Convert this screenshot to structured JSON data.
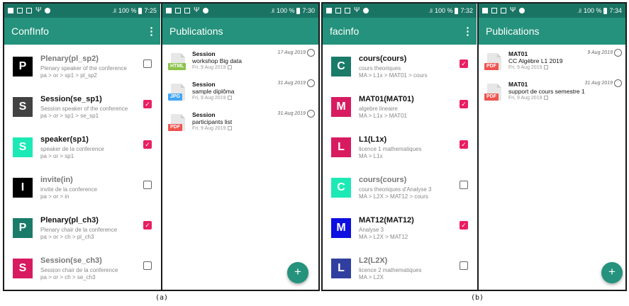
{
  "colors": {
    "statusbar": "#1a7464",
    "appbar": "#24927c",
    "checkbox_checked": "#e91e63",
    "html_tag": "#8bc34a",
    "jpg_tag": "#42a5f5",
    "pdf_tag": "#ef5350"
  },
  "panel_a": {
    "caption": "(a)",
    "screen1": {
      "status": {
        "signal": ".il",
        "battery": "100 %",
        "time": "7:25"
      },
      "title": "ConfInfo",
      "menu_icon": "more-vert-icon",
      "items": [
        {
          "letter": "P",
          "title": "Plenary(pl_sp2)",
          "subtitle": "Plenary speaker of the conference",
          "path": "pa > or > sp1 > pl_sp2",
          "checked": false,
          "color": "#000000"
        },
        {
          "letter": "S",
          "title": "Session(se_sp1)",
          "subtitle": "Session speaker of the conference",
          "path": "pa > or > sp1 > se_sp1",
          "checked": true,
          "color": "#424242"
        },
        {
          "letter": "S",
          "title": "speaker(sp1)",
          "subtitle": "speaker de la conference",
          "path": "pa > or > sp1",
          "checked": true,
          "color": "#1de9b6"
        },
        {
          "letter": "I",
          "title": "invite(in)",
          "subtitle": "invite de la conference",
          "path": "pa > or > in",
          "checked": false,
          "color": "#000000"
        },
        {
          "letter": "P",
          "title": "Plenary(pl_ch3)",
          "subtitle": "Plenary chair de la conference",
          "path": "pa > or > ch > pl_ch3",
          "checked": true,
          "color": "#1a7b69"
        },
        {
          "letter": "S",
          "title": "Session(se_ch3)",
          "subtitle": "Session chair de la conference",
          "path": "pa > or > ch > se_ch3",
          "checked": false,
          "color": "#d81b60"
        }
      ]
    },
    "screen2": {
      "status": {
        "signal": ".il",
        "battery": "100 %",
        "time": "7:30"
      },
      "title": "Publications",
      "publications": [
        {
          "name": "Session",
          "description": "workshop Big data",
          "date": "Fri, 9 Aug 2019",
          "time": "17 Aug 2019",
          "filetype": "HTML"
        },
        {
          "name": "Session",
          "description": "sample diplôma",
          "date": "Fri, 9 Aug 2019",
          "time": "31 Aug 2019",
          "filetype": "JPG"
        },
        {
          "name": "Session",
          "description": "participants list",
          "date": "Fri, 9 Aug 2019",
          "time": "31 Aug 2019",
          "filetype": "PDF"
        }
      ],
      "fab_label": "+"
    }
  },
  "panel_b": {
    "caption": "(b)",
    "screen1": {
      "status": {
        "signal": ".il",
        "battery": "100 %",
        "time": "7:32"
      },
      "title": "facinfo",
      "menu_icon": "more-vert-icon",
      "items": [
        {
          "letter": "C",
          "title": "cours(cours)",
          "subtitle": "cours theoriques",
          "path": "MA > L1x > MAT01 > cours",
          "checked": true,
          "color": "#1a7b69"
        },
        {
          "letter": "M",
          "title": "MAT01(MAT01)",
          "subtitle": "algebre lineaire",
          "path": "MA > L1x > MAT01",
          "checked": true,
          "color": "#d81b60"
        },
        {
          "letter": "L",
          "title": "L1(L1x)",
          "subtitle": "licence 1 mathematiques",
          "path": "MA > L1x",
          "checked": true,
          "color": "#d81b60"
        },
        {
          "letter": "C",
          "title": "cours(cours)",
          "subtitle": "cours theoriques d'Analyse 3",
          "path": "MA > L2X > MAT12 > cours",
          "checked": false,
          "color": "#1de9b6"
        },
        {
          "letter": "M",
          "title": "MAT12(MAT12)",
          "subtitle": "Analyse 3",
          "path": "MA > L2X > MAT12",
          "checked": true,
          "color": "#0d10e0"
        },
        {
          "letter": "L",
          "title": "L2(L2X)",
          "subtitle": "licence 2 mathematiques",
          "path": "MA > L2X",
          "checked": false,
          "color": "#303f9f"
        }
      ]
    },
    "screen2": {
      "status": {
        "signal": ".il",
        "battery": "100 %",
        "time": "7:34"
      },
      "title": "Publications",
      "publications": [
        {
          "name": "MAT01",
          "description": "CC Algèbre L1 2019",
          "date": "Fri, 9 Aug 2019",
          "time": "9 Aug 2019",
          "filetype": "PDF"
        },
        {
          "name": "MAT01",
          "description": "support de cours semestre 1",
          "date": "Fri, 9 Aug 2019",
          "time": "31 Aug 2019",
          "filetype": "PDF"
        }
      ],
      "fab_label": "+"
    }
  }
}
